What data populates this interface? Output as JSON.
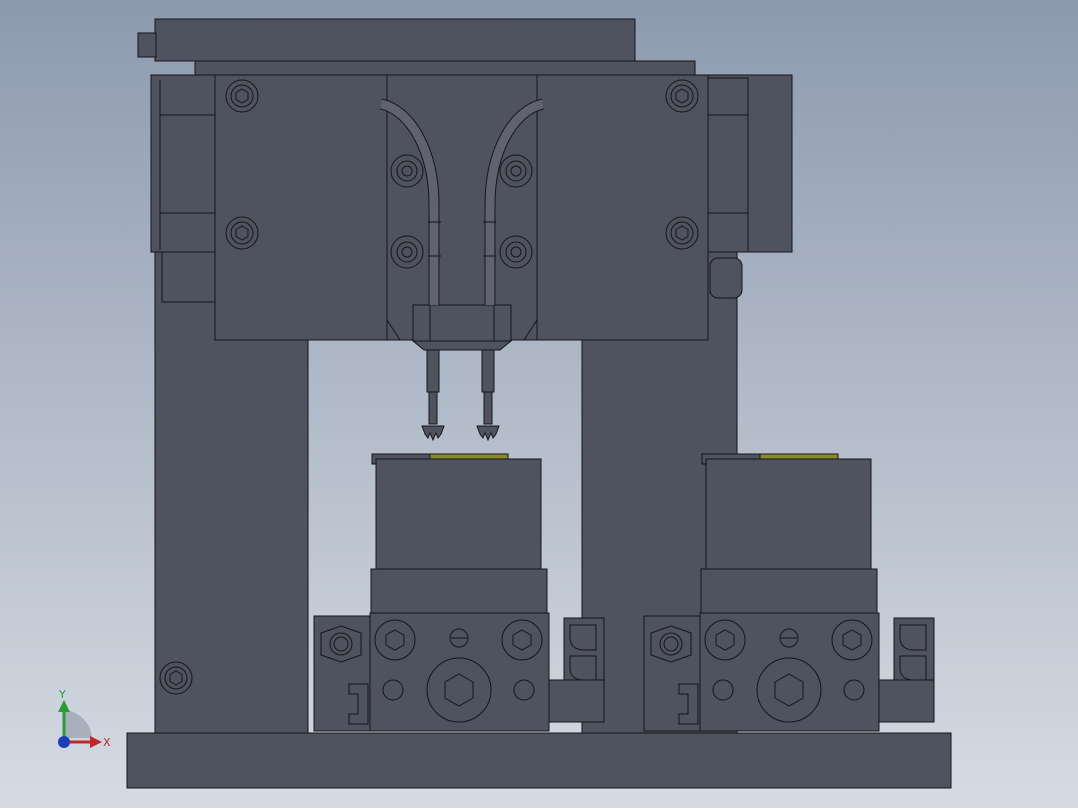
{
  "viewport": {
    "background_top": "#8d9aae",
    "background_bottom": "#d6dbe3"
  },
  "colors": {
    "part_fill": "#4f525f",
    "part_fill_dark": "#444652",
    "part_fill_light": "#5b5e6b",
    "edge": "#15161b",
    "tube": "#60636f",
    "pad_yellow": "#8a8a2a"
  },
  "triad": {
    "x_label": "X",
    "y_label": "Y",
    "x_color": "#c0262c",
    "y_color": "#2a9b3a",
    "z_color": "#1b3fb5"
  }
}
